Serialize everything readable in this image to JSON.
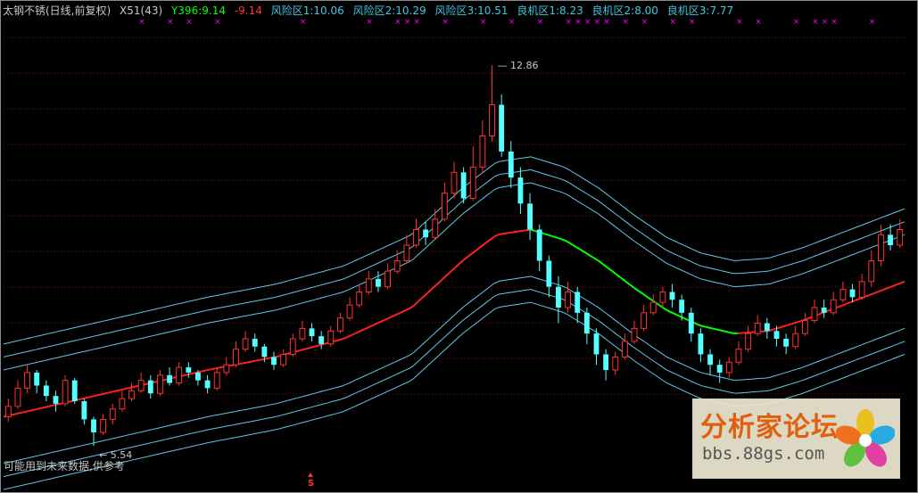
{
  "header": {
    "stock": "太钢不锈(日线,前复权)",
    "indicator": "X51(43)",
    "y396": "Y396:9.14",
    "neg": "-9.14",
    "risk1": "风险区1:10.06",
    "risk2": "风险区2:10.29",
    "risk3": "风险区3:10.51",
    "good1": "良机区1:8.23",
    "good2": "良机区2:8.00",
    "good3": "良机区3:7.77"
  },
  "note": "可能用到未来数据,供参考",
  "markers": {
    "cross": "×",
    "signal": "S"
  },
  "watermark": {
    "title": "分析家论坛",
    "url": "bbs.88gs.com"
  },
  "colors": {
    "up": "#ff3232",
    "down": "#54ffff",
    "ma_up": "#ff2020",
    "ma_down": "#00ff00",
    "band": "#60c8e8",
    "grid": "#8b0000",
    "mark": "#ff00ff",
    "header_white": "#c8c8c8",
    "header_green": "#00ff00",
    "header_red": "#ff3232",
    "header_cyan": "#40c8e0"
  },
  "chart_data": {
    "type": "candlestick",
    "title": "太钢不锈(日线,前复权)",
    "ylim": [
      5.2,
      13.6
    ],
    "annotations": [
      {
        "label": "12.86",
        "value": 12.86,
        "kind": "high"
      },
      {
        "label": "5.54",
        "value": 5.54,
        "kind": "low"
      }
    ],
    "series": [
      {
        "name": "Y396",
        "color": "#ff2020",
        "description": "centre line"
      },
      {
        "name": "风险区1"
      },
      {
        "name": "风险区2"
      },
      {
        "name": "风险区3"
      },
      {
        "name": "良机区1"
      },
      {
        "name": "良机区2"
      },
      {
        "name": "良机区3"
      }
    ],
    "centre_line": [
      [
        0,
        6.1
      ],
      [
        20,
        6.4
      ],
      [
        40,
        6.7
      ],
      [
        60,
        7.0
      ],
      [
        80,
        7.25
      ],
      [
        100,
        7.6
      ],
      [
        120,
        8.2
      ],
      [
        135,
        9.1
      ],
      [
        145,
        9.6
      ],
      [
        155,
        9.7
      ],
      [
        165,
        9.5
      ],
      [
        175,
        9.1
      ],
      [
        185,
        8.6
      ],
      [
        195,
        8.15
      ],
      [
        205,
        7.85
      ],
      [
        215,
        7.7
      ],
      [
        225,
        7.75
      ],
      [
        235,
        7.95
      ],
      [
        245,
        8.2
      ],
      [
        255,
        8.45
      ],
      [
        265,
        8.7
      ]
    ],
    "band_offsets": [
      1.4,
      1.15,
      0.9,
      -0.9,
      -1.15,
      -1.4
    ],
    "candles": [
      [
        6.1,
        6.3,
        6.45,
        6.0
      ],
      [
        6.3,
        6.65,
        6.8,
        6.25
      ],
      [
        6.65,
        6.95,
        7.1,
        6.55
      ],
      [
        6.95,
        6.7,
        7.0,
        6.55
      ],
      [
        6.7,
        6.5,
        6.8,
        6.4
      ],
      [
        6.5,
        6.35,
        6.6,
        6.2
      ],
      [
        6.35,
        6.8,
        6.9,
        6.3
      ],
      [
        6.8,
        6.4,
        6.85,
        6.35
      ],
      [
        6.4,
        6.05,
        6.45,
        5.95
      ],
      [
        6.05,
        5.8,
        6.1,
        5.54
      ],
      [
        5.8,
        6.05,
        6.15,
        5.75
      ],
      [
        6.05,
        6.25,
        6.35,
        5.95
      ],
      [
        6.25,
        6.45,
        6.6,
        6.2
      ],
      [
        6.45,
        6.6,
        6.75,
        6.4
      ],
      [
        6.6,
        6.8,
        6.95,
        6.55
      ],
      [
        6.8,
        6.55,
        6.9,
        6.45
      ],
      [
        6.55,
        6.9,
        7.0,
        6.5
      ],
      [
        6.9,
        6.75,
        7.05,
        6.7
      ],
      [
        6.75,
        7.05,
        7.15,
        6.7
      ],
      [
        7.05,
        6.95,
        7.15,
        6.85
      ],
      [
        6.95,
        6.8,
        7.0,
        6.7
      ],
      [
        6.8,
        6.65,
        6.9,
        6.55
      ],
      [
        6.65,
        6.95,
        7.05,
        6.6
      ],
      [
        6.95,
        7.1,
        7.25,
        6.9
      ],
      [
        7.1,
        7.4,
        7.55,
        7.05
      ],
      [
        7.4,
        7.6,
        7.75,
        7.35
      ],
      [
        7.6,
        7.45,
        7.7,
        7.35
      ],
      [
        7.45,
        7.25,
        7.5,
        7.15
      ],
      [
        7.25,
        7.1,
        7.35,
        7.0
      ],
      [
        7.1,
        7.3,
        7.4,
        7.05
      ],
      [
        7.3,
        7.6,
        7.7,
        7.25
      ],
      [
        7.6,
        7.8,
        7.95,
        7.55
      ],
      [
        7.8,
        7.65,
        7.9,
        7.55
      ],
      [
        7.65,
        7.5,
        7.75,
        7.4
      ],
      [
        7.5,
        7.75,
        7.85,
        7.45
      ],
      [
        7.75,
        8.0,
        8.1,
        7.7
      ],
      [
        8.0,
        8.25,
        8.4,
        7.95
      ],
      [
        8.25,
        8.5,
        8.65,
        8.2
      ],
      [
        8.5,
        8.75,
        8.9,
        8.45
      ],
      [
        8.75,
        8.6,
        8.9,
        8.5
      ],
      [
        8.6,
        8.9,
        9.05,
        8.55
      ],
      [
        8.9,
        9.1,
        9.3,
        8.85
      ],
      [
        9.1,
        9.4,
        9.6,
        9.05
      ],
      [
        9.4,
        9.7,
        9.9,
        9.35
      ],
      [
        9.7,
        9.55,
        9.85,
        9.4
      ],
      [
        9.55,
        9.9,
        10.1,
        9.5
      ],
      [
        9.9,
        10.4,
        10.6,
        9.85
      ],
      [
        10.4,
        10.8,
        11.0,
        10.3
      ],
      [
        10.8,
        10.3,
        10.9,
        10.2
      ],
      [
        10.3,
        10.9,
        11.3,
        10.25
      ],
      [
        10.9,
        11.5,
        11.8,
        10.8
      ],
      [
        11.5,
        12.1,
        12.86,
        11.4
      ],
      [
        12.1,
        11.2,
        12.3,
        11.1
      ],
      [
        11.2,
        10.7,
        11.4,
        10.5
      ],
      [
        10.7,
        10.2,
        10.9,
        10.0
      ],
      [
        10.2,
        9.7,
        10.4,
        9.5
      ],
      [
        9.7,
        9.1,
        9.8,
        8.9
      ],
      [
        9.1,
        8.6,
        9.2,
        8.4
      ],
      [
        8.6,
        8.2,
        8.8,
        7.9
      ],
      [
        8.2,
        8.5,
        8.7,
        8.1
      ],
      [
        8.5,
        8.1,
        8.6,
        7.9
      ],
      [
        8.1,
        7.7,
        8.2,
        7.5
      ],
      [
        7.7,
        7.3,
        7.8,
        7.1
      ],
      [
        7.3,
        7.0,
        7.4,
        6.8
      ],
      [
        7.0,
        7.25,
        7.35,
        6.9
      ],
      [
        7.25,
        7.55,
        7.7,
        7.2
      ],
      [
        7.55,
        7.8,
        7.95,
        7.5
      ],
      [
        7.8,
        8.1,
        8.25,
        7.75
      ],
      [
        8.1,
        8.3,
        8.45,
        8.05
      ],
      [
        8.3,
        8.5,
        8.6,
        8.2
      ],
      [
        8.5,
        8.35,
        8.65,
        8.2
      ],
      [
        8.35,
        8.1,
        8.45,
        7.95
      ],
      [
        8.1,
        7.7,
        8.2,
        7.55
      ],
      [
        7.7,
        7.3,
        7.8,
        7.15
      ],
      [
        7.3,
        7.1,
        7.4,
        6.9
      ],
      [
        7.1,
        6.95,
        7.2,
        6.75
      ],
      [
        6.95,
        7.15,
        7.25,
        6.85
      ],
      [
        7.15,
        7.4,
        7.55,
        7.1
      ],
      [
        7.4,
        7.7,
        7.85,
        7.35
      ],
      [
        7.7,
        7.9,
        8.05,
        7.65
      ],
      [
        7.9,
        7.75,
        8.0,
        7.6
      ],
      [
        7.75,
        7.6,
        7.85,
        7.45
      ],
      [
        7.6,
        7.45,
        7.7,
        7.3
      ],
      [
        7.45,
        7.7,
        7.85,
        7.4
      ],
      [
        7.7,
        7.95,
        8.1,
        7.65
      ],
      [
        7.95,
        8.2,
        8.35,
        7.9
      ],
      [
        8.2,
        8.1,
        8.35,
        8.0
      ],
      [
        8.1,
        8.35,
        8.5,
        8.05
      ],
      [
        8.35,
        8.55,
        8.7,
        8.3
      ],
      [
        8.55,
        8.4,
        8.65,
        8.3
      ],
      [
        8.4,
        8.7,
        8.85,
        8.35
      ],
      [
        8.7,
        9.1,
        9.3,
        8.6
      ],
      [
        9.1,
        9.6,
        9.8,
        9.0
      ],
      [
        9.6,
        9.4,
        9.8,
        9.3
      ],
      [
        9.4,
        9.7,
        9.9,
        9.35
      ]
    ]
  }
}
